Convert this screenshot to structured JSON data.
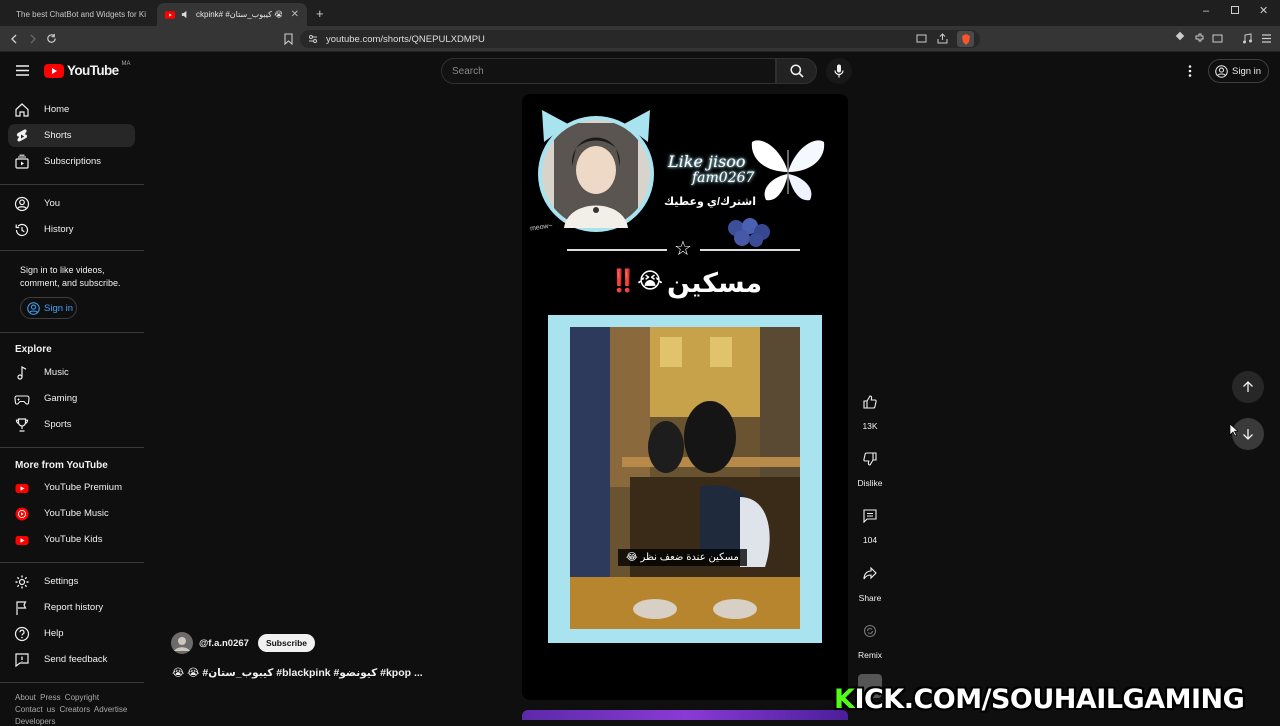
{
  "browser": {
    "tabs": [
      {
        "title": "The best ChatBot and Widgets for Ki",
        "active": false
      },
      {
        "title": "ckpink# #كيبوب_ستان 😭😭",
        "active": true
      }
    ],
    "url": "youtube.com/shorts/QNEPULXDMPU"
  },
  "header": {
    "logo_text": "YouTube",
    "region": "MA",
    "search_placeholder": "Search",
    "signin_label": "Sign in"
  },
  "sidebar": {
    "main": [
      {
        "label": "Home",
        "icon": "home-icon"
      },
      {
        "label": "Shorts",
        "icon": "shorts-icon",
        "active": true
      },
      {
        "label": "Subscriptions",
        "icon": "subscriptions-icon"
      }
    ],
    "you": [
      {
        "label": "You",
        "icon": "you-icon"
      },
      {
        "label": "History",
        "icon": "history-icon"
      }
    ],
    "signin_prompt": "Sign in to like videos, comment, and subscribe.",
    "signin_button": "Sign in",
    "explore_title": "Explore",
    "explore": [
      {
        "label": "Music",
        "icon": "music-icon"
      },
      {
        "label": "Gaming",
        "icon": "gaming-icon"
      },
      {
        "label": "Sports",
        "icon": "sports-icon"
      }
    ],
    "more_title": "More from YouTube",
    "more": [
      {
        "label": "YouTube Premium",
        "icon": "youtube-premium-icon"
      },
      {
        "label": "YouTube Music",
        "icon": "youtube-music-icon"
      },
      {
        "label": "YouTube Kids",
        "icon": "youtube-kids-icon"
      }
    ],
    "settings": [
      {
        "label": "Settings",
        "icon": "gear-icon"
      },
      {
        "label": "Report history",
        "icon": "flag-icon"
      },
      {
        "label": "Help",
        "icon": "help-icon"
      },
      {
        "label": "Send feedback",
        "icon": "feedback-icon"
      }
    ],
    "footer_line1": "About Press Copyright",
    "footer_line2": "Contact us Creators Advertise",
    "footer_line3": "Developers"
  },
  "short": {
    "overlay": {
      "brand_line1": "Like jisoo",
      "brand_line2": "fam0267",
      "brand_line3": "اشترك/ي وعطيك",
      "meow": "meow~",
      "headline": "مسكين",
      "headline_emoji": "‼️😭",
      "caption": "مسكين عندة ضعف نظر 😂"
    },
    "channel": "@f.a.n0267",
    "subscribe_label": "Subscribe",
    "title": "😭 😭 #كيبوب_ستان #blackpink #كيونضو #kpop ...",
    "actions": {
      "likes": "13K",
      "dislike": "Dislike",
      "comments": "104",
      "share": "Share",
      "remix": "Remix"
    }
  },
  "watermark": {
    "first_letter": "K",
    "rest": "ICK.COM/SOUHAILGAMING"
  },
  "colors": {
    "youtube_red": "#ff0000",
    "frame_cyan": "#a9e3ef",
    "kick_green": "#53fc18"
  }
}
